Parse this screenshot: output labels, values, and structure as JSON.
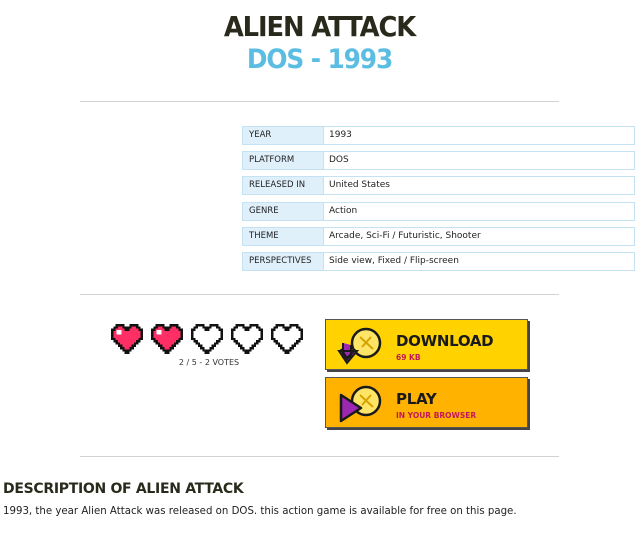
{
  "game": {
    "title": "ALIEN ATTACK",
    "subtitle": "DOS - 1993"
  },
  "info": [
    {
      "key": "YEAR",
      "value": "1993"
    },
    {
      "key": "PLATFORM",
      "value": "DOS"
    },
    {
      "key": "RELEASED IN",
      "value": "United States"
    },
    {
      "key": "GENRE",
      "value": "Action"
    },
    {
      "key": "THEME",
      "value": "Arcade, Sci-Fi / Futuristic, Shooter"
    },
    {
      "key": "PERSPECTIVES",
      "value": "Side view, Fixed / Flip-screen"
    }
  ],
  "rating": {
    "score": 2,
    "max": 5,
    "votes_text": "2 / 5 - 2 VOTES",
    "colors": {
      "filled": "#ff2e64",
      "empty": "#ffffff"
    }
  },
  "buttons": {
    "download": {
      "label": "DOWNLOAD",
      "sub": "69 KB",
      "color": "#ffd200"
    },
    "play": {
      "label": "PLAY",
      "sub": "IN YOUR BROWSER",
      "color": "#ffb300"
    }
  },
  "description": {
    "title": "DESCRIPTION OF ALIEN ATTACK",
    "text": "1993, the year Alien Attack was released on DOS. this action game is available for free on this page."
  },
  "colors": {
    "accent": "#5cbde3",
    "info_bg": "#dff0fb"
  }
}
